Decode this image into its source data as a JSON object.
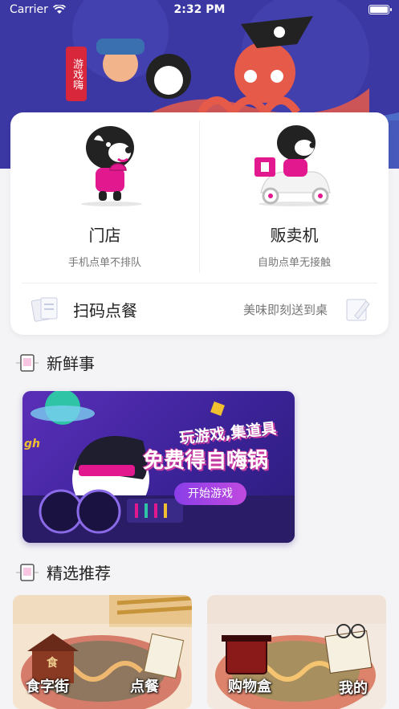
{
  "status": {
    "carrier": "Carrier",
    "time": "2:32 PM"
  },
  "hero": {
    "vertical_text": "游戏嗨"
  },
  "stores": [
    {
      "title": "门店",
      "subtitle": "手机点单不排队",
      "icon": "mascot-store-icon"
    },
    {
      "title": "贩卖机",
      "subtitle": "自助点单无接触",
      "icon": "mascot-scooter-icon"
    }
  ],
  "scan": {
    "label": "扫码点餐",
    "right": "美味即刻送到桌"
  },
  "sections": {
    "news": "新鲜事",
    "recommend": "精选推荐"
  },
  "banner": {
    "headline": "玩游戏,集道具",
    "main": "免费得自嗨锅",
    "button": "开始游戏",
    "tag": "gh"
  },
  "recommend": [
    {
      "left": "食字街",
      "right": "点餐",
      "sign": "食"
    },
    {
      "left": "购物盒",
      "right": "我的"
    }
  ],
  "colors": {
    "brand": "#3d3aa6",
    "accent": "#e2188f"
  }
}
